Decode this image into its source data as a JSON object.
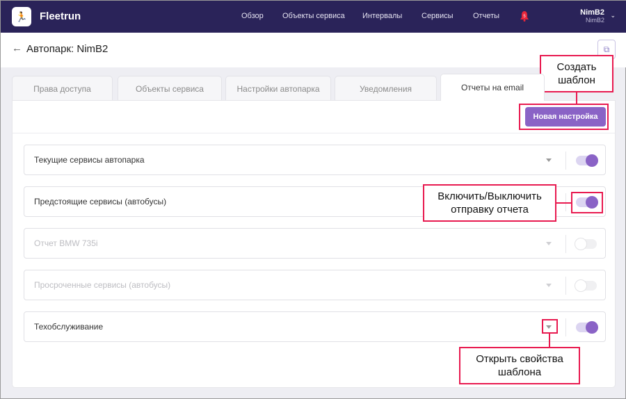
{
  "nav": {
    "brand": "Fleetrun",
    "items": [
      "Обзор",
      "Объекты сервиса",
      "Интервалы",
      "Сервисы",
      "Отчеты"
    ],
    "notifications": "5",
    "user": "NimB2",
    "account": "NimB2"
  },
  "header": {
    "title": "Автопарк: NimB2"
  },
  "tabs": [
    "Права доступа",
    "Объекты сервиса",
    "Настройки автопарка",
    "Уведомления",
    "Отчеты на email"
  ],
  "new_button": "Новая настройка",
  "rows": [
    {
      "label": "Текущие сервисы автопарка",
      "enabled": true
    },
    {
      "label": "Предстоящие сервисы (автобусы)",
      "enabled": true
    },
    {
      "label": "Отчет BMW 735i",
      "enabled": false
    },
    {
      "label": "Просроченные сервисы (автобусы)",
      "enabled": false
    },
    {
      "label": "Техобслуживание",
      "enabled": true
    }
  ],
  "annotations": {
    "create": "Создать шаблон",
    "toggle": "Включить/Выключить отправку отчета",
    "open": "Открыть свойства шаблона"
  },
  "colors": {
    "nav": "#2a2359",
    "accent": "#8a63c6",
    "annotation": "#e8194f"
  }
}
